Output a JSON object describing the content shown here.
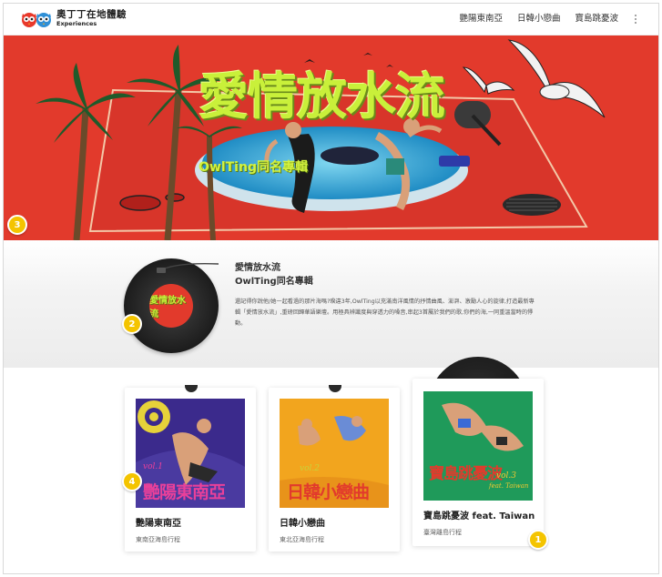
{
  "header": {
    "brand_name": "奧丁丁在地體驗",
    "brand_tagline": "Experiences",
    "logo_icon": "owl-logo-icon",
    "nav": [
      {
        "label": "艷陽東南亞"
      },
      {
        "label": "日韓小戀曲"
      },
      {
        "label": "寶島跳憂波"
      }
    ],
    "more_icon": "kebab-menu-icon"
  },
  "hero": {
    "title": "愛情放水流",
    "subtitle": "OwlTing同名專輯",
    "colors": {
      "background": "#e23a2c",
      "title": "#c9f03a",
      "pool": "#3ab0d8"
    }
  },
  "album": {
    "title": "愛情放水流",
    "subtitle": "OwlTing同名專輯",
    "disc_label": "愛情放水流",
    "description": "還記得你說他/她一起看過的那片海嗎?睽違3年,OwlTing以充滿南洋風情的抒情曲風、澎湃、激勵人心的旋律,打造最新專輯「愛情放水流」,重磅回歸華語樂壇。用極具辨識度與穿透力的嗓音,串起3首屬於我們的歌,你們的海,一同重溫當時的悸動。"
  },
  "cards": [
    {
      "art_title": "艷陽東南亞",
      "vol": "vol.1",
      "title": "艷陽東南亞",
      "desc": "東南亞海島行程",
      "color": "#3b2a8c"
    },
    {
      "art_title": "日韓小戀曲",
      "vol": "vol.2",
      "title": "日韓小戀曲",
      "desc": "東北亞海島行程",
      "color": "#f2a51e"
    },
    {
      "art_title": "寶島跳憂波",
      "vol": "vol.3",
      "art_extra": "feat. Taiwan",
      "title": "寶島跳憂波 feat. Taiwan",
      "desc": "臺灣離島行程",
      "color": "#1f9a5a"
    }
  ],
  "badges": [
    "1",
    "2",
    "3",
    "4"
  ],
  "accent": "#f4c400"
}
